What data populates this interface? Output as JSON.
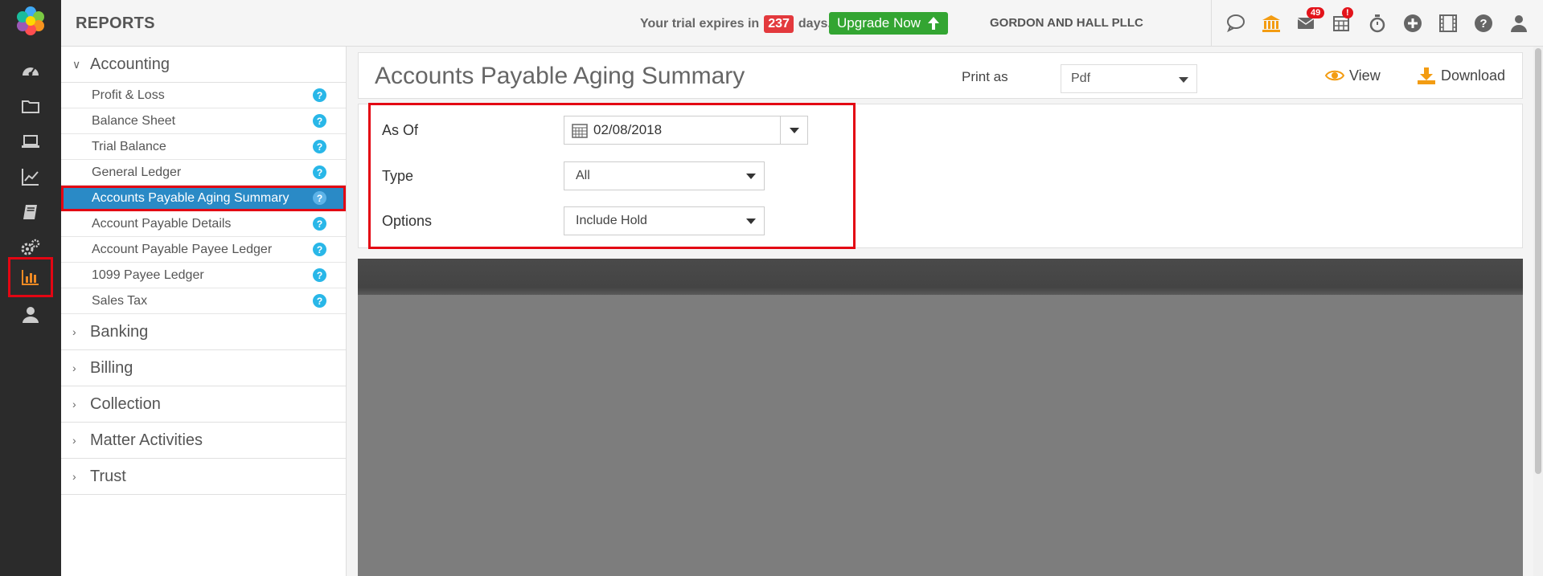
{
  "header": {
    "title": "REPORTS",
    "trial_prefix": "Your trial expires in",
    "trial_days": "237",
    "trial_suffix": "days.",
    "upgrade_label": "Upgrade Now",
    "firm_name": "GORDON AND HALL PLLC",
    "mail_badge": "49",
    "calendar_badge": "!"
  },
  "rail": {
    "items": [
      "dashboard-icon",
      "folder-icon",
      "laptop-icon",
      "chart-line-icon",
      "book-icon",
      "cogs-icon",
      "bar-chart-icon",
      "user-icon"
    ],
    "active": "bar-chart-icon"
  },
  "sidebar": {
    "groups": [
      {
        "label": "Accounting",
        "expanded": true,
        "items": [
          {
            "label": "Profit & Loss"
          },
          {
            "label": "Balance Sheet"
          },
          {
            "label": "Trial Balance"
          },
          {
            "label": "General Ledger"
          },
          {
            "label": "Accounts Payable Aging Summary",
            "selected": true
          },
          {
            "label": "Account Payable Details"
          },
          {
            "label": "Account Payable Payee Ledger"
          },
          {
            "label": "1099 Payee Ledger"
          },
          {
            "label": "Sales Tax"
          }
        ]
      },
      {
        "label": "Banking",
        "expanded": false
      },
      {
        "label": "Billing",
        "expanded": false
      },
      {
        "label": "Collection",
        "expanded": false
      },
      {
        "label": "Matter Activities",
        "expanded": false
      },
      {
        "label": "Trust",
        "expanded": false
      }
    ],
    "help_glyph": "?"
  },
  "main": {
    "page_title": "Accounts Payable Aging Summary",
    "print_label": "Print as",
    "print_value": "Pdf",
    "view_label": "View",
    "download_label": "Download",
    "filters": {
      "as_of_label": "As Of",
      "as_of_value": "02/08/2018",
      "type_label": "Type",
      "type_value": "All",
      "options_label": "Options",
      "options_value": "Include Hold"
    }
  },
  "colors": {
    "rail_bg": "#2b2b2b",
    "accent_blue": "#2a8ac6",
    "upgrade_green": "#33a532",
    "highlight_red": "#e30613",
    "orange": "#f39c12"
  }
}
